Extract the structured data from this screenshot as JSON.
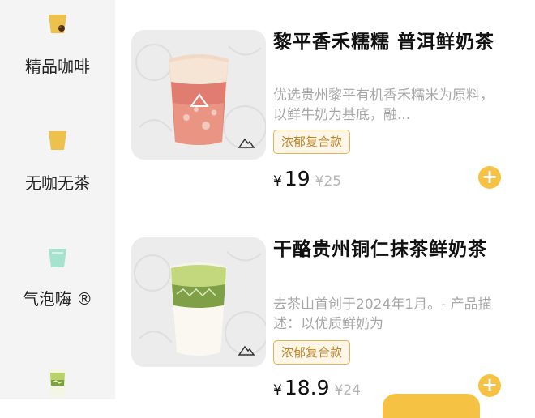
{
  "sidebar": {
    "categories": [
      {
        "label": "精品咖啡",
        "icon": "coffee-cup-icon"
      },
      {
        "label": "无咖无茶",
        "icon": "yellow-cup-icon"
      },
      {
        "label": "气泡嗨 ®",
        "icon": "green-cup-icon"
      },
      {
        "label": "",
        "icon": "matcha-drink-icon"
      }
    ]
  },
  "products": [
    {
      "name": "黎平香禾糯糯 普洱鲜奶茶",
      "description": "优选贵州黎平有机香禾糯米为原料，以鲜牛奶为基底，融...",
      "tag": "浓郁复合款",
      "currency": "¥",
      "price": "19",
      "original_price": "¥25",
      "image": "pink-milk-tea-image"
    },
    {
      "name": "干酪贵州铜仁抹茶鲜奶茶",
      "description": "去茶山首创于2024年1月。- 产品描述：以优质鲜奶为",
      "tag": "浓郁复合款",
      "currency": "¥",
      "price": "18.9",
      "original_price": "¥24",
      "image": "matcha-milk-tea-image"
    }
  ],
  "colors": {
    "accent": "#f5c244",
    "tag_text": "#c0872a",
    "tag_border": "#e3b25a",
    "sidebar_bg": "#f4f4f4"
  }
}
